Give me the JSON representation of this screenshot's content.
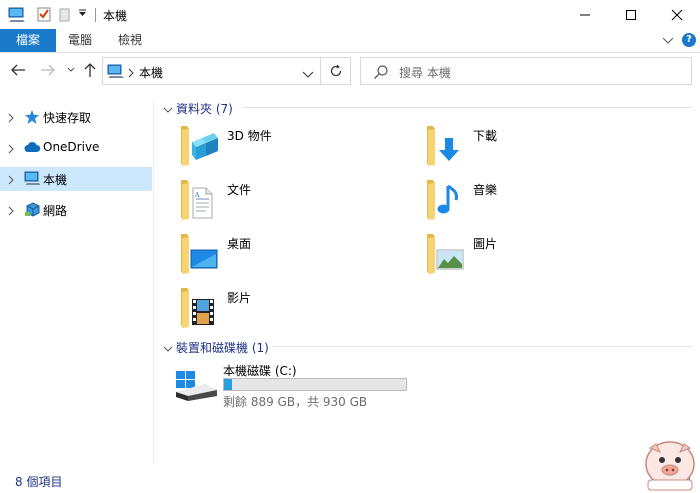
{
  "window": {
    "title": "本機"
  },
  "ribbon": {
    "tabs": [
      {
        "label": "檔案"
      },
      {
        "label": "電腦"
      },
      {
        "label": "檢視"
      }
    ],
    "help_label": "?"
  },
  "address": {
    "path": "本機"
  },
  "search": {
    "placeholder": "搜尋 本機"
  },
  "sidebar": {
    "items": [
      {
        "label": "快速存取"
      },
      {
        "label": "OneDrive"
      },
      {
        "label": "本機"
      },
      {
        "label": "網路"
      }
    ]
  },
  "groups": {
    "folders": {
      "label": "資料夾 (7)"
    },
    "devices": {
      "label": "裝置和磁碟機 (1)"
    }
  },
  "folders": [
    {
      "name": "3D 物件",
      "icon": "3d-objects-icon"
    },
    {
      "name": "下載",
      "icon": "downloads-icon"
    },
    {
      "name": "文件",
      "icon": "documents-icon"
    },
    {
      "name": "音樂",
      "icon": "music-icon"
    },
    {
      "name": "桌面",
      "icon": "desktop-icon"
    },
    {
      "name": "圖片",
      "icon": "pictures-icon"
    },
    {
      "name": "影片",
      "icon": "videos-icon"
    }
  ],
  "drive": {
    "name": "本機磁碟 (C:)",
    "free_text": "剩餘 889 GB，共 930 GB",
    "used_fraction": 0.044
  },
  "status": {
    "item_count": "8 個項目"
  },
  "colors": {
    "accent": "#1979ca",
    "selection": "#cce8ff",
    "group_text": "#1e3287",
    "folder": "#f6d473",
    "drive_bar": "#26a0da"
  }
}
